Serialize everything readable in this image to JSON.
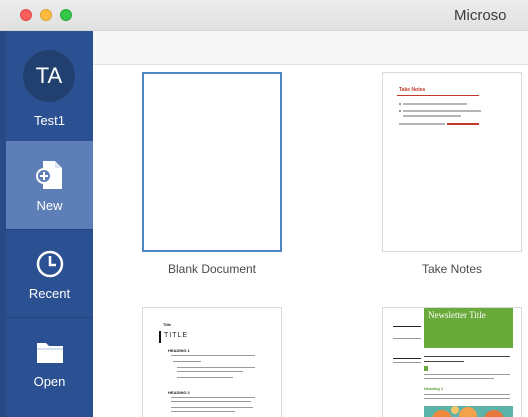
{
  "window": {
    "title": "Microso"
  },
  "sidebar": {
    "user": {
      "initials": "TA",
      "name": "Test1"
    },
    "items": [
      {
        "label": "New",
        "icon": "new-document-icon",
        "active": true
      },
      {
        "label": "Recent",
        "icon": "clock-icon",
        "active": false
      },
      {
        "label": "Open",
        "icon": "folder-icon",
        "active": false
      }
    ]
  },
  "templates": [
    {
      "caption": "Blank Document",
      "selected": true
    },
    {
      "caption": "Take Notes",
      "selected": false,
      "preview": {
        "title": "Take Notes",
        "link_text": "www.example.com"
      }
    },
    {
      "caption": "",
      "selected": false,
      "preview": {
        "label": "Title",
        "title": "TITLE",
        "heading_1": "HEADING 1",
        "heading_2": "HEADING 2"
      }
    },
    {
      "caption": "",
      "selected": false,
      "preview": {
        "title": "Newsletter Title",
        "heading": "Heading 1"
      }
    }
  ],
  "colors": {
    "sidebar": "#2c5193",
    "sidebar_active": "#5d7eb6",
    "selection_border": "#4f86c6",
    "newsletter_green": "#6aaa3a"
  }
}
